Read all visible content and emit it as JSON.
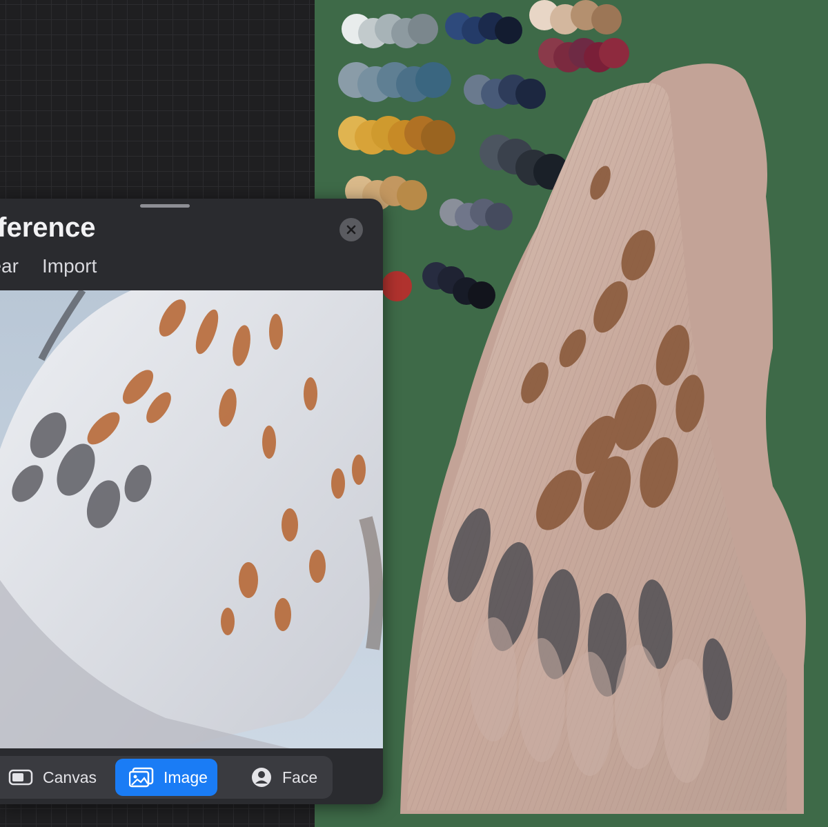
{
  "panel": {
    "title": "Reference",
    "close_icon": "close-icon",
    "menu": {
      "clear_label": "Clear",
      "import_label": "Import"
    },
    "tabs": [
      {
        "label": "Canvas",
        "icon": "canvas-icon",
        "active": false
      },
      {
        "label": "Image",
        "icon": "image-icon",
        "active": true
      },
      {
        "label": "Face",
        "icon": "face-icon",
        "active": false
      }
    ]
  },
  "colors": {
    "accent": "#1a7cf5",
    "panel_bg": "#2a2b2f",
    "canvas_bg": "#3e6a48",
    "workspace_bg": "#1f1f21"
  },
  "palette": [
    [
      "#e8ecec",
      "#c2cacc",
      "#a7b3b7",
      "#8d9aa0",
      "#7b878d"
    ],
    [
      "#2e4a7c",
      "#243b68",
      "#1b2a4c",
      "#131c30"
    ],
    [
      "#e8d6c6",
      "#d3b79e",
      "#b4906f",
      "#9c7656"
    ],
    [
      "#8a3a4a",
      "#7b2a3f",
      "#6e2a44",
      "#7a1f38",
      "#8e2a3e"
    ],
    [
      "#8a9ca8",
      "#7790a0",
      "#5f7f93",
      "#4b7088",
      "#3a6680"
    ],
    [
      "#6a7a8e",
      "#485a78",
      "#2e3c5a",
      "#1c2740"
    ],
    [
      "#e0b450",
      "#d8a338",
      "#cf9a2e",
      "#c78a26",
      "#b07124",
      "#9a6420"
    ],
    [
      "#4c5560",
      "#3a414c",
      "#2a3038",
      "#1a2028"
    ],
    [
      "#d9b98a",
      "#cfa976",
      "#c39760",
      "#b88a48"
    ],
    [
      "#8a8f9a",
      "#70768a",
      "#5a6074",
      "#454b5e"
    ],
    [
      "#b0322e"
    ],
    [
      "#272c40",
      "#1f2333",
      "#171b27",
      "#12141c"
    ]
  ]
}
